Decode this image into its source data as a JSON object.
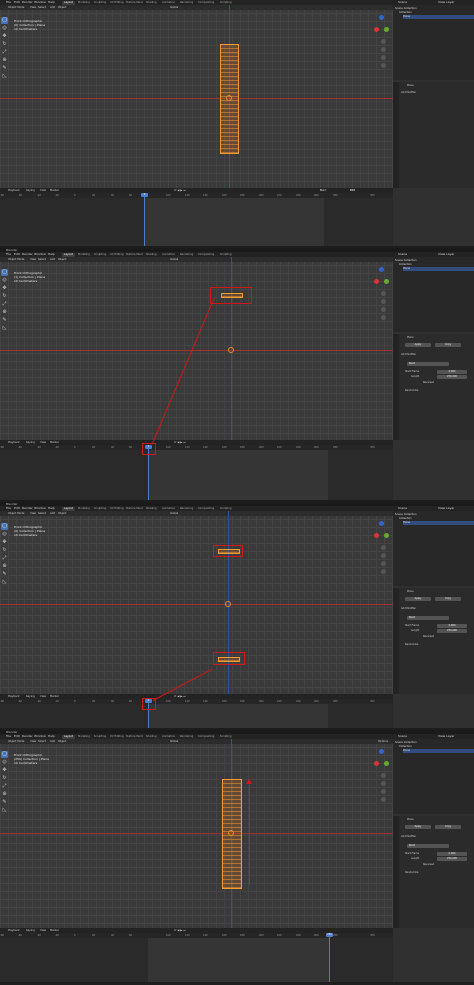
{
  "app": {
    "title": "Blender"
  },
  "menu": [
    "File",
    "Edit",
    "Render",
    "Window",
    "Help"
  ],
  "workspaces": [
    "Layout",
    "Modeling",
    "Sculpting",
    "UV Editing",
    "Texture Paint",
    "Shading",
    "Animation",
    "Rendering",
    "Compositing",
    "Scripting"
  ],
  "scene": {
    "name": "Scene",
    "view_layer": "View Layer"
  },
  "viewport_header": {
    "mode": "Object Mode",
    "view": "View",
    "select": "Select",
    "add": "Add",
    "object": "Object",
    "orientation": "Global",
    "options": "Options"
  },
  "overlay": {
    "line1": "Front Orthographic",
    "line2": "(0) Collection | Plane",
    "line3": "10 Centimeters"
  },
  "overlay_variants": [
    {
      "line1": "Front Orthographic",
      "line2": "(0) Collection | Plane",
      "line3": "10 Centimeters"
    },
    {
      "line1": "Front Orthographic",
      "line2": "(1) Collection | Plane",
      "line3": "10 Centimeters"
    },
    {
      "line1": "Front Orthographic",
      "line2": "(0) Collection | Plane",
      "line3": "10 Centimeters"
    },
    {
      "line1": "Front Orthographic",
      "line2": "(250) Collection | Plane",
      "line3": "10 Centimeters"
    }
  ],
  "outliner": {
    "scene_collection": "Scene Collection",
    "collection": "Collection",
    "plane": "Plane"
  },
  "properties": {
    "object_name": "Plane",
    "add_modifier": "Add Modifier",
    "apply": "Apply",
    "copy": "Copy",
    "modifier_name": "Build",
    "start_frame_label": "Start Frame",
    "start_frame_value": "0.000",
    "length_label": "Length",
    "length_value": "250.000",
    "reversed_label": "Reversed",
    "randomize_label": "Randomize"
  },
  "timeline_header": {
    "playback": "Playback",
    "keying": "Keying",
    "view": "View",
    "marker": "Marker",
    "start_label": "Start",
    "start_value": "0",
    "end_label": "End",
    "end_value": "250"
  },
  "ruler_ticks": [
    "-80",
    "-60",
    "-40",
    "-20",
    "0",
    "20",
    "40",
    "60",
    "80",
    "100",
    "120",
    "140",
    "160",
    "180",
    "200",
    "220",
    "240",
    "260",
    "280",
    "300"
  ],
  "playhead_frames": [
    "0",
    "1",
    "0",
    "250"
  ],
  "colors": {
    "accent": "#4772b3",
    "object": "#f29b32",
    "highlight": "#d01818",
    "x_axis": "#b03030",
    "z_axis": "#3050a0"
  }
}
